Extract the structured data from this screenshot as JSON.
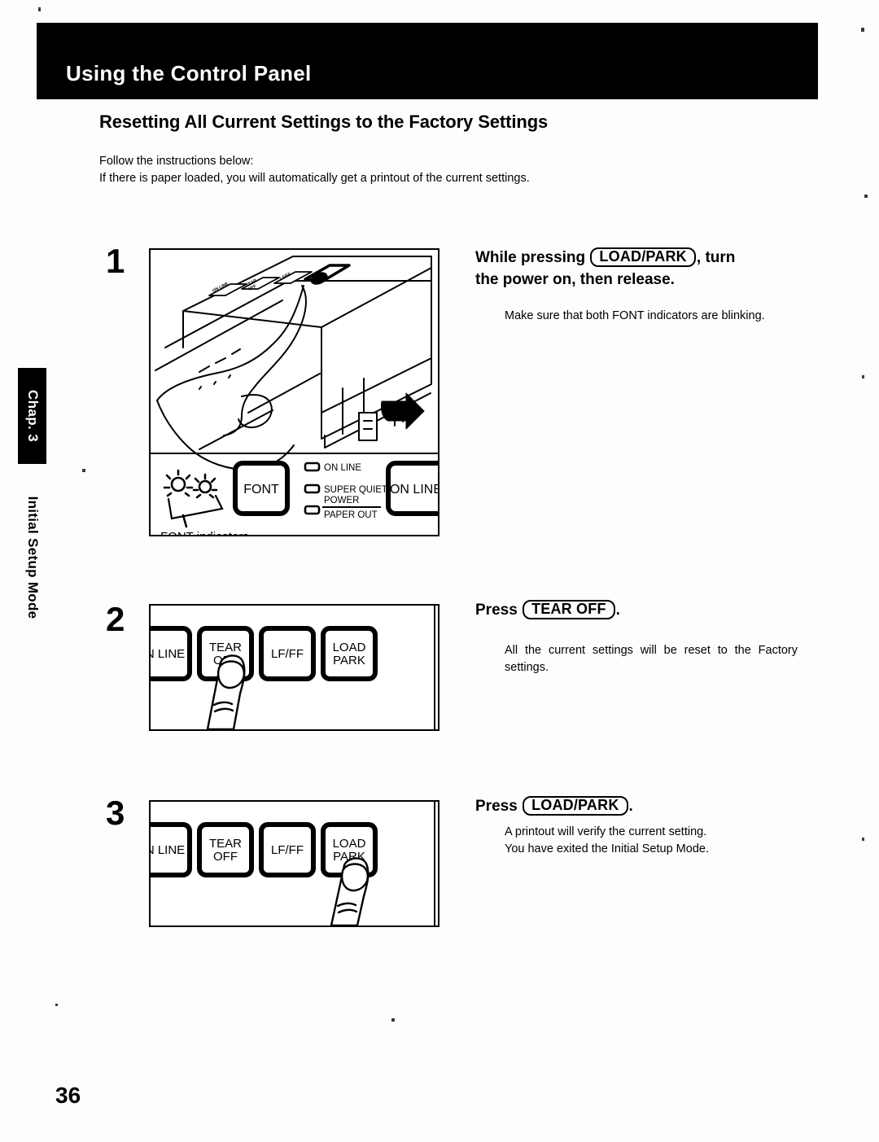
{
  "header": {
    "title": "Using the Control Panel"
  },
  "sidebar": {
    "chapter_tab": "Chap. 3",
    "chapter_name": "Initial Setup Mode"
  },
  "section": {
    "heading": "Resetting All Current Settings to the Factory Settings",
    "intro_line1": "Follow the instructions below:",
    "intro_line2": "If there is paper loaded, you will automatically get a printout of the current settings."
  },
  "steps": [
    {
      "number": "1",
      "title_pre": "While  pressing",
      "title_key": "LOAD/PARK",
      "title_post": ",  turn",
      "title_line2": "the power on, then release.",
      "body": "Make sure that both FONT indicators are blinking.",
      "figure": {
        "font_button_label": "FONT",
        "online_button_label": "ON LINE",
        "indicator_online": "ON LINE",
        "indicator_super_quiet": "SUPER QUIET",
        "indicator_power": "POWER",
        "indicator_paper_out": "PAPER OUT",
        "caption": "FONT indicators",
        "printer_keys": [
          "ON LINE",
          "TEAR OFF",
          "LF/FF",
          "LOAD PARK"
        ]
      }
    },
    {
      "number": "2",
      "title_pre": "Press",
      "title_key": "TEAR OFF",
      "title_post": ".",
      "title_line2": "",
      "body": "All the current settings will be reset to the Factory settings.",
      "figure": {
        "keys": [
          "N LINE",
          "TEAR\nOFF",
          "LF/FF",
          "LOAD\nPARK"
        ],
        "key1_line1": "N LINE",
        "key2_line1": "TEAR",
        "key2_line2": "OFF",
        "key3_line1": "LF/FF",
        "key4_line1": "LOAD",
        "key4_line2": "PARK",
        "pressed_key_index": 1
      }
    },
    {
      "number": "3",
      "title_pre": "Press",
      "title_key": "LOAD/PARK",
      "title_post": ".",
      "title_line2": "",
      "body_line1": "A printout will verify the current setting.",
      "body_line2": "You have exited the Initial Setup Mode.",
      "figure": {
        "key1_line1": "N LINE",
        "key2_line1": "TEAR",
        "key2_line2": "OFF",
        "key3_line1": "LF/FF",
        "key4_line1": "LOAD",
        "key4_line2": "PARK",
        "pressed_key_index": 3
      }
    }
  ],
  "footer": {
    "page_number": "36"
  },
  "colors": {
    "ink": "#000000",
    "paper": "#fdfdfb",
    "header_bar": "#000000"
  }
}
